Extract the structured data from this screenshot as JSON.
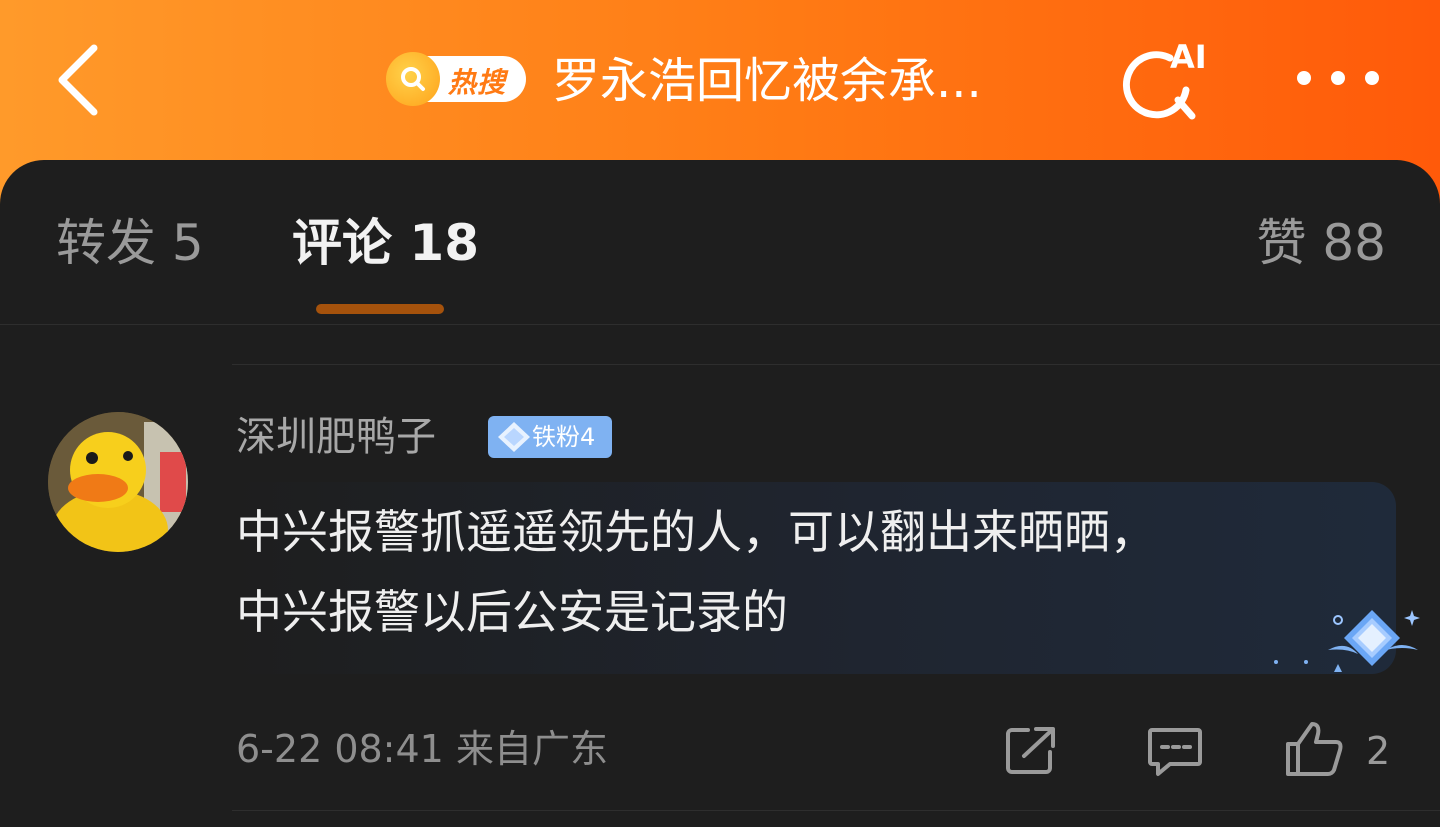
{
  "header": {
    "back_icon": "chevron-left-icon",
    "hot_badge_label": "热搜",
    "title": "罗永浩回忆被余承...",
    "ai_search_label": "AI",
    "ai_search_icon": "ai-search-icon",
    "more_icon": "more-dots-icon",
    "gradient_colors": [
      "#ff9a2a",
      "#ff5a0a"
    ]
  },
  "tabs": {
    "repost": "转发 5",
    "comment": "评论 18",
    "like": "赞 88",
    "active_tab": "comment",
    "indicator_color": "#a5520c"
  },
  "comment": {
    "username": "深圳肥鸭子",
    "avatar_icon": "rubber-duck-avatar",
    "fan_badge": "铁粉4",
    "fan_badge_color": "#7fb2f2",
    "lines": [
      "中兴报警抓遥遥领先的人，可以翻出来晒晒，",
      "中兴报警以后公安是记录的"
    ],
    "date": "6-22 08:41",
    "location": "来自广东",
    "like_count": "2",
    "actions": [
      "share-icon",
      "reply-icon",
      "thumbs-up-icon"
    ]
  }
}
